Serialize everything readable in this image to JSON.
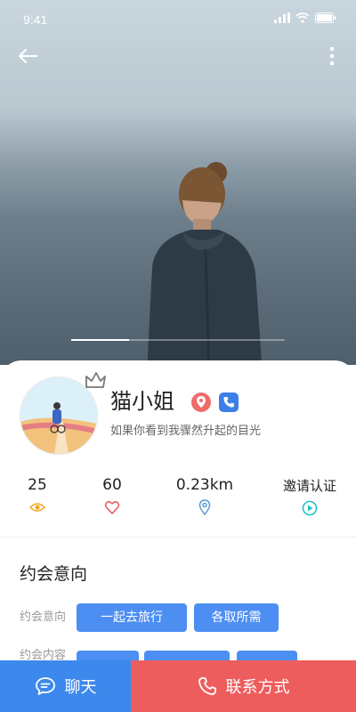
{
  "status_bar": {
    "time": "9:41"
  },
  "profile": {
    "name": "猫小姐",
    "bio": "如果你看到我骤然升起的目光"
  },
  "gallery": {
    "progress": 0.27
  },
  "stats": [
    {
      "value": "25",
      "icon": "eye-icon",
      "color": "#f5a623"
    },
    {
      "value": "60",
      "icon": "heart-icon",
      "color": "#e85555"
    },
    {
      "value": "0.23km",
      "icon": "location-icon",
      "color": "#5b9bd5"
    },
    {
      "value": "邀请认证",
      "icon": "play-circle-icon",
      "color": "#1fc3c8"
    }
  ],
  "dating": {
    "section_title": "约会意向",
    "intent_label": "约会意向",
    "intent_tags": [
      "一起去旅行",
      "各取所需"
    ],
    "content_label": "约会内容"
  },
  "actions": {
    "chat_label": "聊天",
    "contact_label": "联系方式"
  },
  "colors": {
    "tag_blue": "#4c8ef2",
    "chat_blue": "#3d88ed",
    "contact_red": "#ee5d5d"
  }
}
